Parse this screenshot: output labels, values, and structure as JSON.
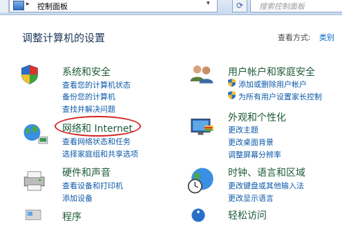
{
  "address_bar": {
    "separator": "▸",
    "breadcrumb": "控制面板",
    "search_placeholder": "搜索控制面板"
  },
  "header": {
    "title": "调整计算机的设置",
    "view_label": "查看方式:",
    "view_value": "类别"
  },
  "categories": {
    "system_security": {
      "title": "系统和安全",
      "links": [
        "查看您的计算机状态",
        "备份您的计算机",
        "查找并解决问题"
      ]
    },
    "user_accounts": {
      "title": "用户帐户和家庭安全",
      "links": [
        "添加或删除用户帐户",
        "为所有用户设置家长控制"
      ]
    },
    "network": {
      "title": "网络和 Internet",
      "links": [
        "查看网络状态和任务",
        "选择家庭组和共享选项"
      ]
    },
    "appearance": {
      "title": "外观和个性化",
      "links": [
        "更改主题",
        "更改桌面背景",
        "调整屏幕分辨率"
      ]
    },
    "hardware": {
      "title": "硬件和声音",
      "links": [
        "查看设备和打印机",
        "添加设备"
      ]
    },
    "clock": {
      "title": "时钟、语言和区域",
      "links": [
        "更改键盘或其他输入法",
        "更改显示语言"
      ]
    },
    "programs": {
      "title": "程序"
    },
    "ease": {
      "title": "轻松访问"
    }
  },
  "colors": {
    "link": "#0b59a8",
    "category_title": "#1e5a3a",
    "highlight_ellipse": "#d42222"
  }
}
